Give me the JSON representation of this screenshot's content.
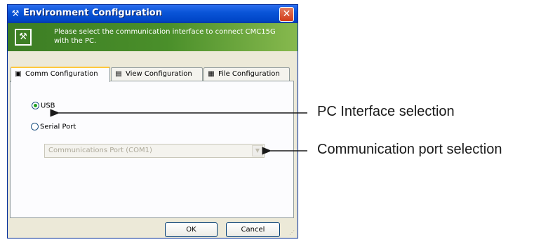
{
  "window": {
    "title": "Environment Configuration",
    "close_label": "✕",
    "banner_text": "Please select the communication interface to connect CMC15G with the PC."
  },
  "tabs": [
    {
      "label": "Comm Configuration",
      "icon": "comm-icon",
      "active": true
    },
    {
      "label": "View Configuration",
      "icon": "view-icon",
      "active": false
    },
    {
      "label": "File Configuration",
      "icon": "file-icon",
      "active": false
    }
  ],
  "comm": {
    "usb_label": "USB",
    "usb_checked": true,
    "serial_label": "Serial Port",
    "serial_checked": false,
    "port_value": "Communications Port (COM1)",
    "port_enabled": false
  },
  "buttons": {
    "ok": "OK",
    "cancel": "Cancel"
  },
  "callouts": {
    "pc_interface": "PC Interface selection",
    "comm_port": "Communication port selection"
  },
  "colors": {
    "titlebar": "#0a55d8",
    "banner": "#4a8f2a",
    "radio_dot": "#21a121"
  }
}
